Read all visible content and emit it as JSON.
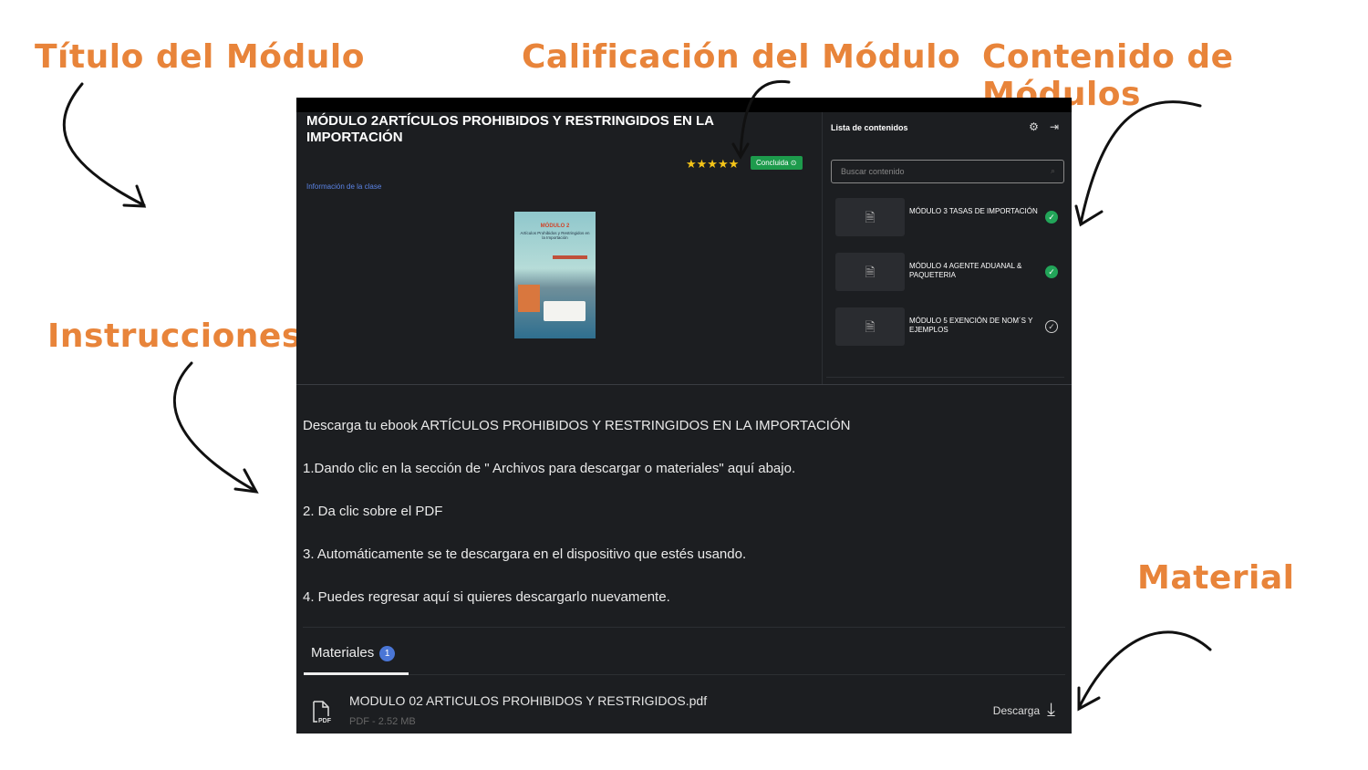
{
  "annotations": {
    "title": "Título del Módulo",
    "rating": "Calificación del Módulo",
    "contents": "Contenido de Módulos",
    "instructions": "Instrucciones",
    "material": "Material"
  },
  "module": {
    "title": "MÓDULO 2ARTÍCULOS PROHIBIDOS Y RESTRINGIDOS EN LA IMPORTACIÓN",
    "rating": 5,
    "stars": "★★★★★",
    "status": "Concluida",
    "info_link": "Información de la clase",
    "cover": {
      "heading": "MÓDULO 2",
      "subtitle": "Artículos Prohibidos y Restringidos en la Importación"
    }
  },
  "sidebar": {
    "title": "Lista de contenidos",
    "search_placeholder": "Buscar contenido",
    "items": [
      {
        "label": "MÓDULO 3 TASAS DE IMPORTACIÓN",
        "completed": true
      },
      {
        "label": "MÓDULO 4 AGENTE ADUANAL & PAQUETERIA",
        "completed": true
      },
      {
        "label": "MÓDULO 5 EXENCIÓN DE NOM´S Y EJEMPLOS",
        "completed": false
      }
    ]
  },
  "instructions": [
    "Descarga tu ebook   ARTÍCULOS PROHIBIDOS Y RESTRINGIDOS EN LA IMPORTACIÓN",
    "1.Dando clic en la sección de \" Archivos para descargar o materiales\" aquí abajo.",
    "2. Da clic sobre el PDF",
    "3. Automáticamente se te descargara en el dispositivo que estés usando.",
    "4. Puedes regresar aquí si quieres descargarlo nuevamente."
  ],
  "materials": {
    "tab_label": "Materiales",
    "count": "1",
    "file": {
      "name": "MODULO 02 ARTICULOS PROHIBIDOS Y RESTRIGIDOS.pdf",
      "meta": "PDF - 2.52 MB",
      "type_label": "PDF"
    },
    "download_label": "Descarga"
  }
}
